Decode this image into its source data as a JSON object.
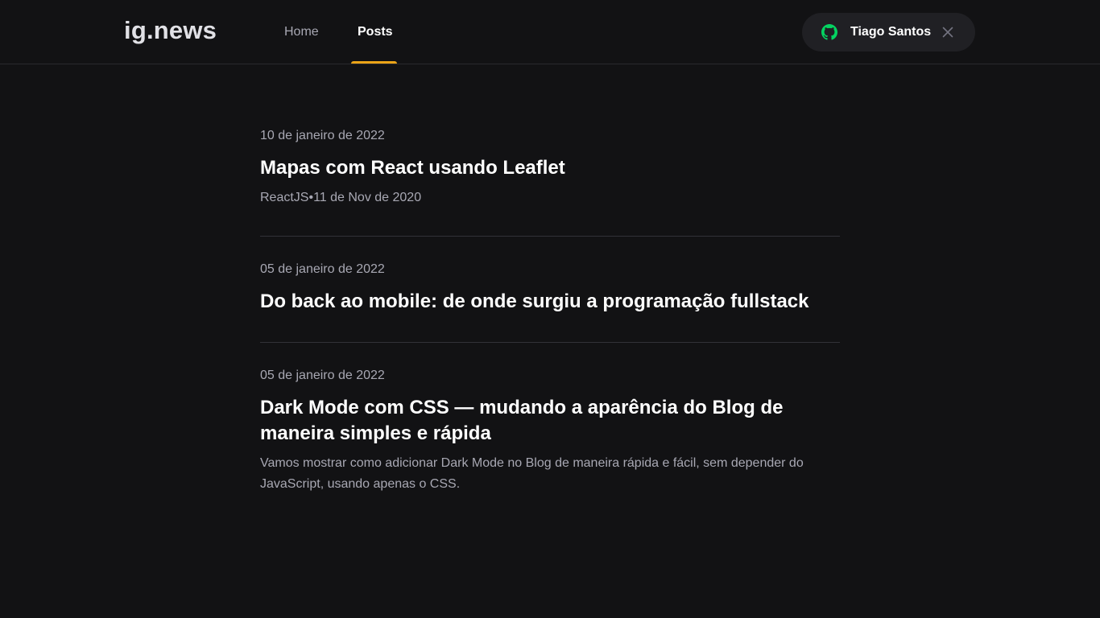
{
  "header": {
    "logo": "ig.news",
    "nav": [
      {
        "label": "Home",
        "active": false
      },
      {
        "label": "Posts",
        "active": true
      }
    ],
    "user": {
      "name": "Tiago Santos",
      "icon": "github-icon",
      "close_icon": "close-icon"
    }
  },
  "colors": {
    "background": "#121214",
    "accent": "#eba417",
    "github_green": "#04d361"
  },
  "posts": [
    {
      "date": "10 de janeiro de 2022",
      "title": "Mapas com React usando Leaflet",
      "excerpt": "ReactJS•11 de Nov de 2020"
    },
    {
      "date": "05 de janeiro de 2022",
      "title": "Do back ao mobile: de onde surgiu a programação fullstack",
      "excerpt": ""
    },
    {
      "date": "05 de janeiro de 2022",
      "title": "Dark Mode com CSS — mudando a aparência do Blog de maneira simples e rápida",
      "excerpt": "Vamos mostrar como adicionar Dark Mode no Blog de maneira rápida e fácil, sem depender do JavaScript, usando apenas o CSS."
    }
  ]
}
